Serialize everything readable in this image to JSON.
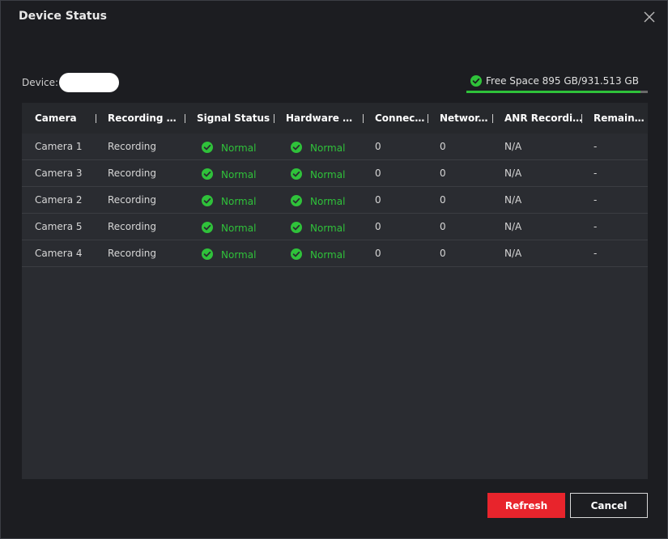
{
  "dialog": {
    "title": "Device Status"
  },
  "device": {
    "label": "Device:",
    "value": ""
  },
  "storage": {
    "free_space_text": "Free Space 895 GB/931.513 GB",
    "free_fraction": 0.961,
    "bar_fill_color": "#2fc23a",
    "bar_track_color": "#6a6a6a"
  },
  "table": {
    "columns": [
      "Camera",
      "Recording St...",
      "Signal Status",
      "Hardware St...",
      "Connect...",
      "Networ...",
      "ANR Recording",
      "Remaini..."
    ],
    "rows": [
      {
        "camera": "Camera 1",
        "recording": "Recording",
        "signal": "Normal",
        "hardware": "Normal",
        "connections": "0",
        "network": "0",
        "anr": "N/A",
        "remaining": "-"
      },
      {
        "camera": "Camera 3",
        "recording": "Recording",
        "signal": "Normal",
        "hardware": "Normal",
        "connections": "0",
        "network": "0",
        "anr": "N/A",
        "remaining": "-"
      },
      {
        "camera": "Camera 2",
        "recording": "Recording",
        "signal": "Normal",
        "hardware": "Normal",
        "connections": "0",
        "network": "0",
        "anr": "N/A",
        "remaining": "-"
      },
      {
        "camera": "Camera 5",
        "recording": "Recording",
        "signal": "Normal",
        "hardware": "Normal",
        "connections": "0",
        "network": "0",
        "anr": "N/A",
        "remaining": "-"
      },
      {
        "camera": "Camera 4",
        "recording": "Recording",
        "signal": "Normal",
        "hardware": "Normal",
        "connections": "0",
        "network": "0",
        "anr": "N/A",
        "remaining": "-"
      }
    ]
  },
  "buttons": {
    "refresh": "Refresh",
    "cancel": "Cancel"
  },
  "colors": {
    "accent_red": "#e8242c",
    "status_green": "#2fc23a",
    "background": "#1c1d21"
  },
  "icons": {
    "close": "close-icon",
    "check": "check-circle-icon"
  }
}
